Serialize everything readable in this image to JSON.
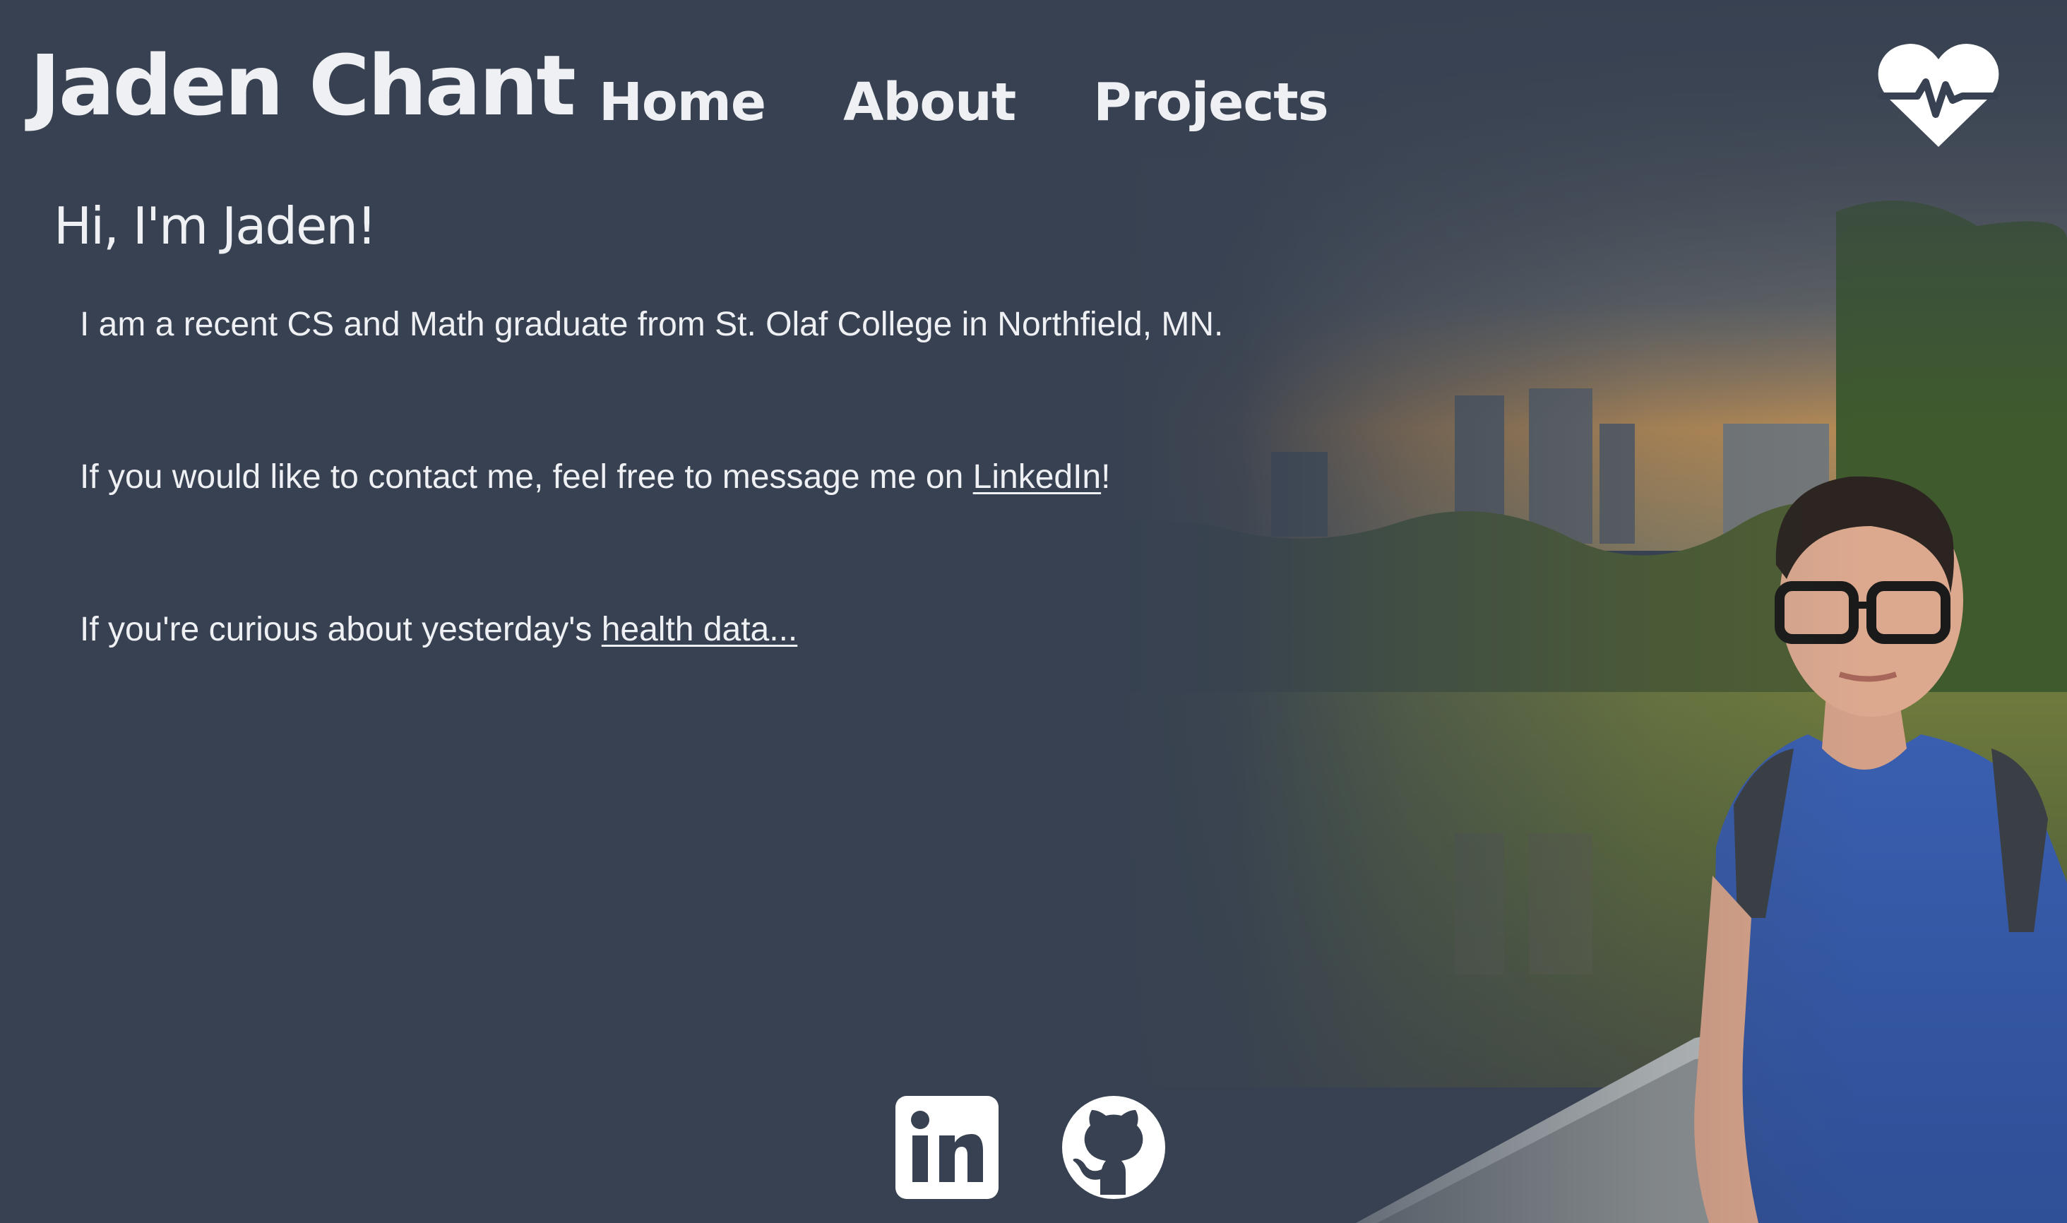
{
  "header": {
    "site_title": "Jaden Chant",
    "nav": [
      {
        "label": "Home"
      },
      {
        "label": "About"
      },
      {
        "label": "Projects"
      }
    ],
    "health_icon": "heart-pulse-icon"
  },
  "main": {
    "greeting": "Hi, I'm Jaden!",
    "intro": "I am a recent CS and Math graduate from St. Olaf College in Northfield, MN.",
    "contact_prefix": "If you would like to contact me, feel free to message me on ",
    "contact_link": "LinkedIn",
    "contact_suffix": "!",
    "health_prefix": "If you're curious about yesterday's ",
    "health_link": "health data..."
  },
  "footer": {
    "social": [
      {
        "icon": "linkedin-icon"
      },
      {
        "icon": "github-icon"
      }
    ]
  },
  "colors": {
    "background": "#374151",
    "text": "#eef0f3"
  }
}
